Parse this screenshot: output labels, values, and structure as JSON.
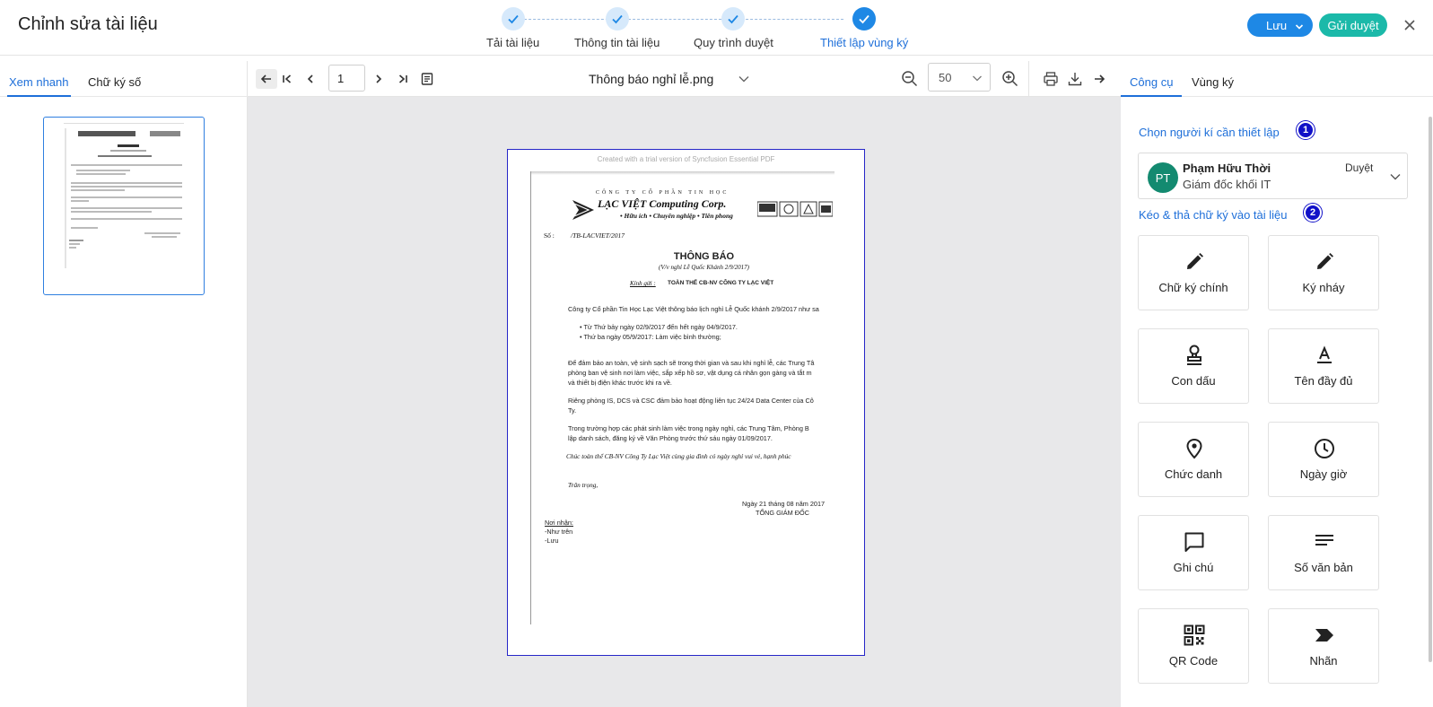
{
  "header": {
    "title": "Chỉnh sửa tài liệu",
    "steps": [
      {
        "label": "Tải tài liệu",
        "state": "done"
      },
      {
        "label": "Thông tin tài liệu",
        "state": "done"
      },
      {
        "label": "Quy trình duyệt",
        "state": "done"
      },
      {
        "label": "Thiết lập vùng ký",
        "state": "active"
      }
    ],
    "save_label": "Lưu",
    "send_label": "Gửi duyệt"
  },
  "left_panel": {
    "tabs": [
      {
        "label": "Xem nhanh",
        "active": true
      },
      {
        "label": "Chữ ký số",
        "active": false
      }
    ]
  },
  "toolbar": {
    "page_number": "1",
    "file_name": "Thông báo nghỉ lễ.png",
    "zoom": "50"
  },
  "document": {
    "watermark": "Created with a trial version of Syncfusion Essential PDF",
    "company_top": "CÔNG TY CỔ PHẦN TIN HỌC",
    "company_name": "LẠC VIỆT Computing Corp.",
    "slogan": "• Hữu ích  • Chuyên nghiệp  • Tiên phong",
    "number_label": "Số :",
    "number_value": "/TB-LACVIET/2017",
    "heading": "THÔNG BÁO",
    "subheading": "(V/v nghỉ Lễ Quốc Khánh 2/9/2017)",
    "kinh_gui_label": "Kính gửi :",
    "kinh_gui_value": "TOÀN THỂ CB-NV CÔNG TY LẠC VIỆT",
    "p1": "Công ty Cổ phần Tin Học Lạc Việt thông báo lịch nghỉ Lễ Quốc khánh 2/9/2017 như sa",
    "b1": "Từ Thứ bảy ngày 02/9/2017 đến hết ngày 04/9/2017.",
    "b2": "Thứ ba ngày 05/9/2017:   Làm việc bình thường;",
    "p2a": "Để đảm bảo an toàn, vệ sinh sạch sẽ trong thời gian và sau khi nghỉ lễ, các Trung Tâ",
    "p2b": "phòng ban vệ sinh nơi làm việc, sắp xếp hồ sơ, vật dụng cá nhân gọn gàng và tắt m",
    "p2c": "và thiết bị điện khác trước khi ra về.",
    "p3a": "Riêng phòng IS, DCS và CSC đảm bảo hoạt động liên tục 24/24 Data Center của Cô",
    "p3b": "Ty.",
    "p4a": "Trong trường hợp các phát sinh làm việc trong ngày nghỉ, các Trung Tâm, Phòng B",
    "p4b": "lập danh sách, đăng ký về Văn Phòng trước thứ sáu ngày 01/09/2017.",
    "p5": "Chúc toàn thể CB-NV Công Ty Lạc Việt cùng gia đình có ngày nghỉ vui vẻ, hạnh phúc",
    "p6": "Trân trọng,",
    "date": "Ngày 21  tháng 08 năm 2017",
    "signer_title": "TỔNG GIÁM ĐỐC",
    "recipients_label": "Nơi nhận:",
    "recipient_1": "-Như trên",
    "recipient_2": "-Lưu"
  },
  "right_panel": {
    "tabs": [
      {
        "label": "Công cụ",
        "active": true
      },
      {
        "label": "Vùng ký",
        "active": false
      }
    ],
    "section_1": "Chọn người kí cần thiết lập",
    "badge_1": "1",
    "signer": {
      "initials": "PT",
      "name": "Phạm Hữu Thời",
      "role": "Giám đốc khối IT",
      "type": "Duyệt"
    },
    "section_2": "Kéo & thả chữ ký vào tài liệu",
    "badge_2": "2",
    "tools": [
      {
        "label": "Chữ ký chính",
        "icon": "pen-icon"
      },
      {
        "label": "Ký nháy",
        "icon": "pen-icon"
      },
      {
        "label": "Con dấu",
        "icon": "stamp-icon"
      },
      {
        "label": "Tên đầy đủ",
        "icon": "text-format-icon"
      },
      {
        "label": "Chức danh",
        "icon": "location-pin-icon"
      },
      {
        "label": "Ngày giờ",
        "icon": "clock-icon"
      },
      {
        "label": "Ghi chú",
        "icon": "comment-icon"
      },
      {
        "label": "Số văn bản",
        "icon": "lines-icon"
      },
      {
        "label": "QR Code",
        "icon": "qr-code-icon"
      },
      {
        "label": "Nhãn",
        "icon": "label-icon"
      }
    ]
  }
}
